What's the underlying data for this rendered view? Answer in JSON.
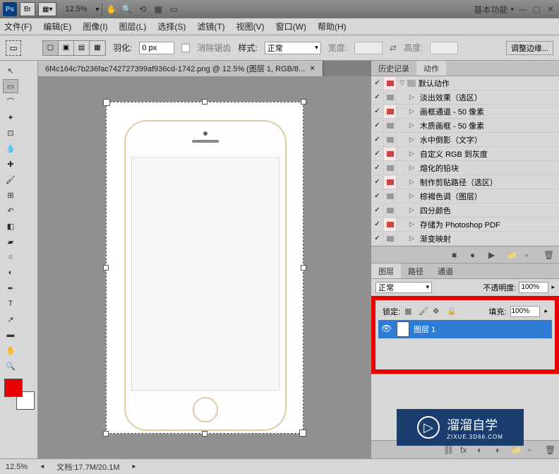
{
  "titlebar": {
    "ps": "Ps",
    "br": "Br",
    "zoom": "12.5%",
    "workspace": "基本功能"
  },
  "menu": {
    "file": "文件(F)",
    "edit": "编辑(E)",
    "image": "图像(I)",
    "layer": "图层(L)",
    "select": "选择(S)",
    "filter": "滤镜(T)",
    "view": "视图(V)",
    "window": "窗口(W)",
    "help": "帮助(H)"
  },
  "options": {
    "feather_label": "羽化:",
    "feather_value": "0 px",
    "antialias": "消除锯齿",
    "style_label": "样式:",
    "style_value": "正常",
    "width_label": "宽度:",
    "height_label": "高度:",
    "refine": "调整边缘..."
  },
  "doc_tab": "6f4c164c7b236fac742727399af936cd-1742.png @ 12.5% (图层 1, RGB/8...",
  "panels": {
    "history_tab": "历史记录",
    "actions_tab": "动作",
    "layers_tab": "图层",
    "paths_tab": "路径",
    "channels_tab": "通道"
  },
  "actions": {
    "root": "默认动作",
    "items": [
      "淡出效果（选区）",
      "画框通道 - 50 像素",
      "木质画框 - 50 像素",
      "水中倒影（文字）",
      "自定义 RGB 到灰度",
      "熔化的铅块",
      "制作剪贴路径（选区）",
      "棕褐色调（图层）",
      "四分颜色",
      "存储为 Photoshop PDF",
      "渐变映射"
    ]
  },
  "layers": {
    "blend": "正常",
    "opacity_label": "不透明度:",
    "opacity": "100%",
    "lock_label": "锁定:",
    "fill_label": "填充:",
    "fill": "100%",
    "layer1": "图层 1"
  },
  "statusbar": {
    "zoom": "12.5%",
    "docinfo": "文档:17.7M/20.1M"
  },
  "watermark": {
    "text": "溜溜自学",
    "sub": "ZIXUE.3D66.COM"
  }
}
